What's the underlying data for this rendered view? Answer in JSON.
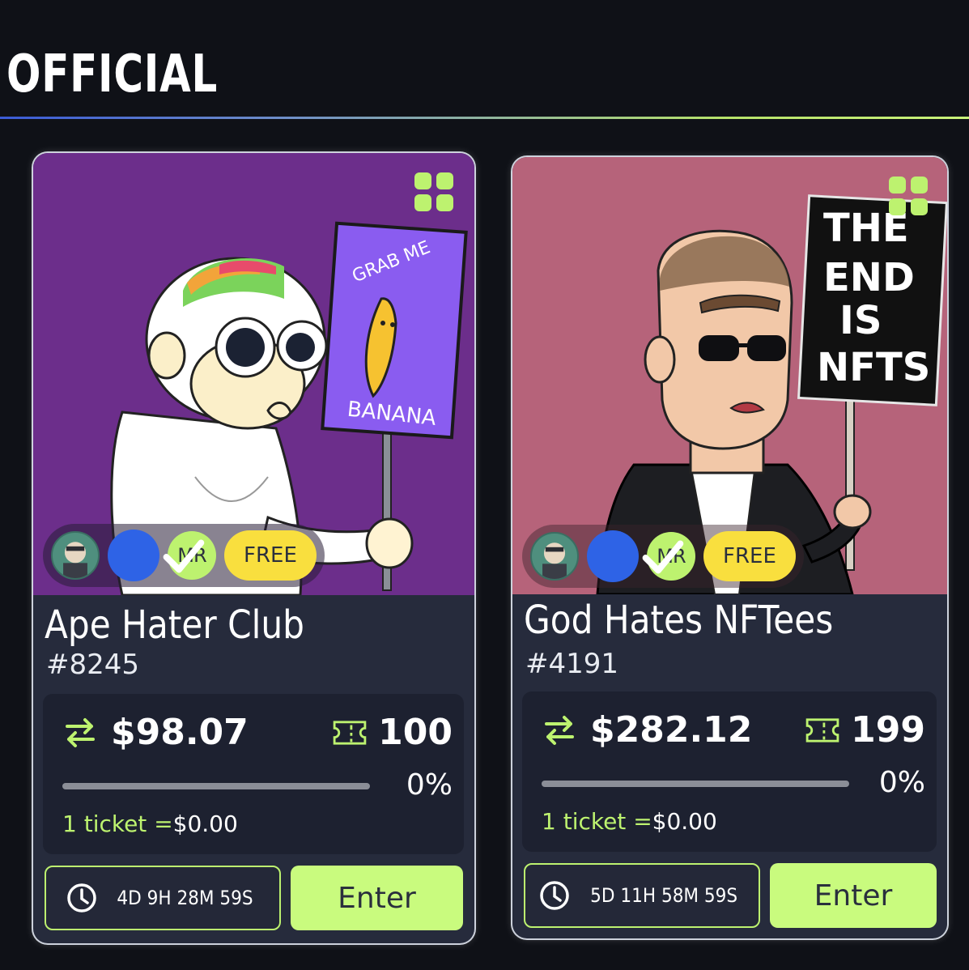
{
  "section": {
    "title": "OFFICIAL"
  },
  "colors": {
    "accent": "#bdf26f",
    "card_bg": "#262b3c",
    "free_badge": "#f9df3e",
    "verified": "#2e63e6"
  },
  "cards": [
    {
      "name": "Ape Hater Club",
      "token_id": "#8245",
      "art_bg": "#6c2e8b",
      "sign_text": [
        "GRAB ME",
        "BANANA"
      ],
      "badges": {
        "mr": "MR",
        "free": "FREE"
      },
      "price": "$98.07",
      "tickets": "100",
      "progress_percent": 0,
      "percent_label": "0%",
      "ticket_price_label": "1 ticket =",
      "ticket_price_value": "$0.00",
      "timer": "4D 9H 28M 59S",
      "enter_label": "Enter"
    },
    {
      "name": "God Hates NFTees",
      "token_id": "#4191",
      "art_bg": "#b6637a",
      "sign_text": [
        "THE",
        "END",
        "IS",
        "NFTS"
      ],
      "badges": {
        "mr": "MR",
        "free": "FREE"
      },
      "price": "$282.12",
      "tickets": "199",
      "progress_percent": 0,
      "percent_label": "0%",
      "ticket_price_label": "1 ticket =",
      "ticket_price_value": "$0.00",
      "timer": "5D 11H 58M 59S",
      "enter_label": "Enter"
    }
  ]
}
